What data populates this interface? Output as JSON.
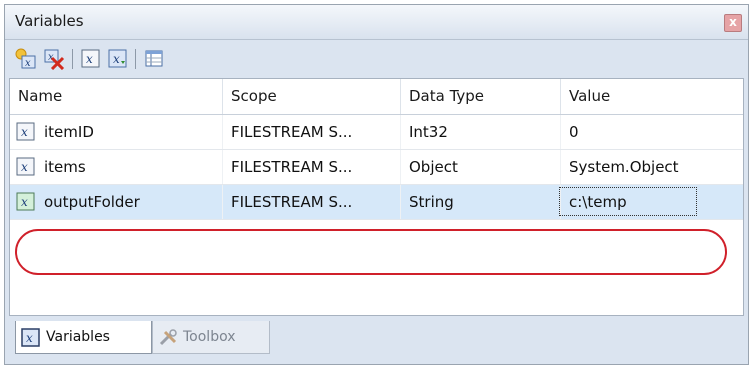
{
  "window": {
    "title": "Variables",
    "close_label": "x"
  },
  "toolbar": {
    "buttons": [
      {
        "icon": "add-variable-icon"
      },
      {
        "icon": "delete-variable-icon"
      },
      {
        "icon": "variable-icon"
      },
      {
        "icon": "variable-options-icon"
      },
      {
        "icon": "grid-options-icon"
      }
    ]
  },
  "grid": {
    "columns": [
      "Name",
      "Scope",
      "Data Type",
      "Value"
    ],
    "rows": [
      {
        "name": "itemID",
        "scope": "FILESTREAM S...",
        "type": "Int32",
        "value": "0",
        "selected": false
      },
      {
        "name": "items",
        "scope": "FILESTREAM S...",
        "type": "Object",
        "value": "System.Object",
        "selected": false
      },
      {
        "name": "outputFolder",
        "scope": "FILESTREAM S...",
        "type": "String",
        "value": "c:\\temp",
        "selected": true
      }
    ]
  },
  "tabs": [
    {
      "label": "Variables",
      "active": true
    },
    {
      "label": "Toolbox",
      "active": false
    }
  ],
  "colors": {
    "highlight": "#d0202a",
    "selected_row": "#d6e8f9"
  }
}
